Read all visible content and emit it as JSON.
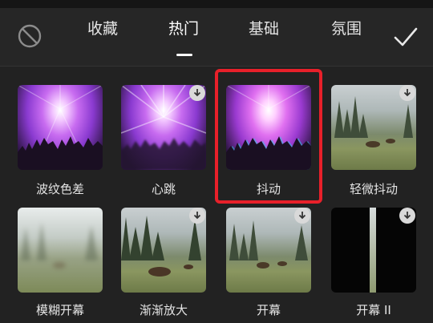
{
  "tabs": [
    {
      "label": "收藏"
    },
    {
      "label": "热门"
    },
    {
      "label": "基础"
    },
    {
      "label": "氛围"
    }
  ],
  "active_tab": "热门",
  "effects": [
    {
      "label": "波纹色差",
      "thumb": "concert",
      "download": false
    },
    {
      "label": "心跳",
      "thumb": "concert-blur",
      "download": true
    },
    {
      "label": "抖动",
      "thumb": "concert-glitch",
      "download": false,
      "selected": true
    },
    {
      "label": "轻微抖动",
      "thumb": "forest",
      "download": true
    },
    {
      "label": "模糊开幕",
      "thumb": "forest-fog",
      "download": false
    },
    {
      "label": "渐渐放大",
      "thumb": "forest",
      "download": true
    },
    {
      "label": "开幕",
      "thumb": "forest",
      "download": true
    },
    {
      "label": "开幕 II",
      "thumb": "forest-split",
      "download": true
    }
  ],
  "colors": {
    "background": "#222222",
    "selection": "#e8202a",
    "accent_text": "#ffffff"
  },
  "icons": {
    "none": "no-effect-icon",
    "confirm": "checkmark-icon",
    "download": "download-icon"
  }
}
